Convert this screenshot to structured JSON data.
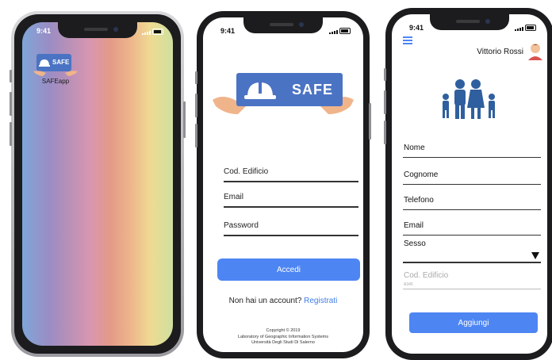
{
  "phone1": {
    "time": "9:41",
    "app_tile_text": "SAFE",
    "app_label": "SAFEapp"
  },
  "phone2": {
    "time": "9:41",
    "logo_text": "SAFE",
    "fields": [
      {
        "label": "Cod. Edificio"
      },
      {
        "label": "Email"
      },
      {
        "label": "Password"
      }
    ],
    "login_button": "Accedi",
    "register_prompt": "Non hai un account?",
    "register_link": "Registrati",
    "footer": [
      "Copyright © 2019",
      "Laboratory of Geographic Information Systems",
      "Università Degli Studi Di Salerno"
    ],
    "colors": {
      "accent": "#4d85f3",
      "logo_bg": "#4b73c4"
    }
  },
  "phone3": {
    "time": "9:41",
    "menu_icon": "hamburger-icon",
    "user_name": "Vittorio Rossi",
    "fields": [
      {
        "label": "Nome"
      },
      {
        "label": "Cognome"
      },
      {
        "label": "Telefono"
      },
      {
        "label": "Email"
      }
    ],
    "select_label": "Sesso",
    "disabled_field_label": "Cod. Edificio",
    "disabled_field_value": "A345",
    "add_button": "Aggiungi"
  }
}
